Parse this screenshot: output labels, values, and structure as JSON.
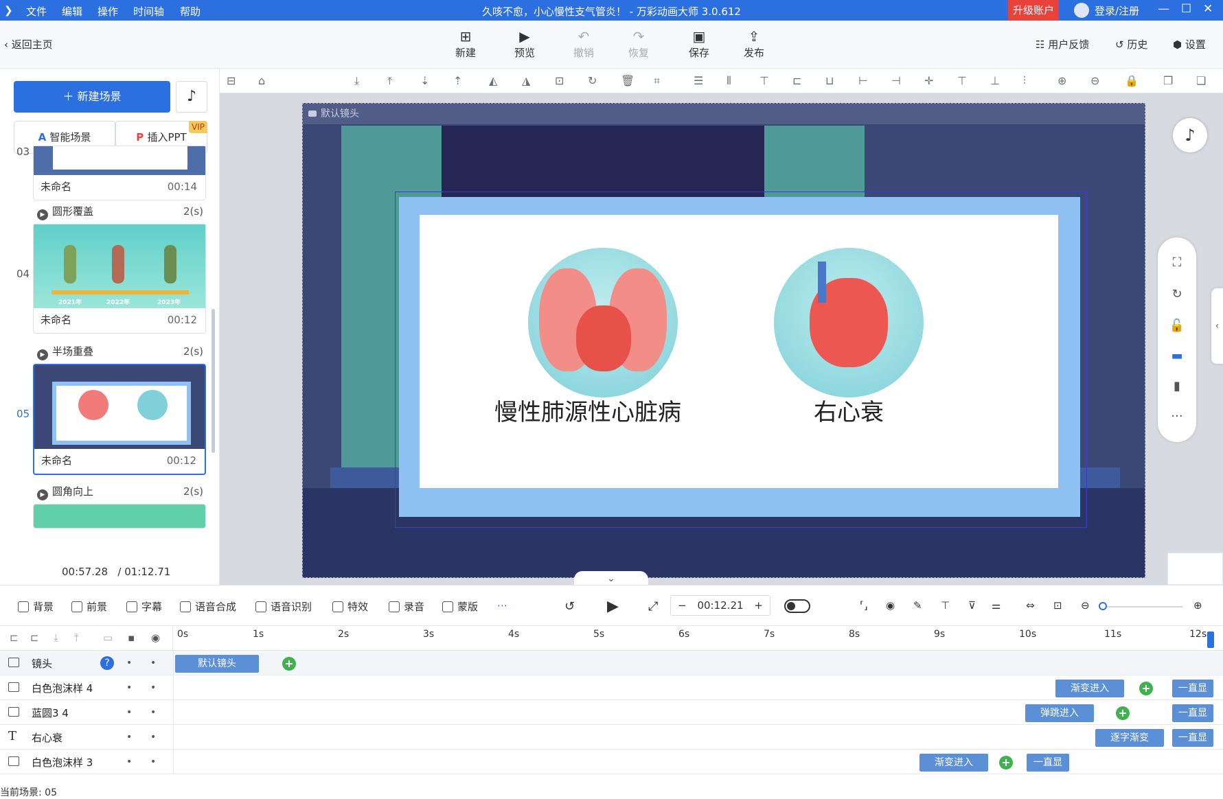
{
  "titlebar": {
    "menus": [
      "文件",
      "编辑",
      "操作",
      "时间轴",
      "帮助"
    ],
    "title": "久咳不愈，小心慢性支气管炎！ - 万彩动画大师 3.0.612",
    "upgrade": "升级账户",
    "login": "登录/注册",
    "accent": "#2c6fe0"
  },
  "toolbar": {
    "back": "返回主页",
    "buttons": [
      {
        "label": "新建",
        "icon": "new-icon"
      },
      {
        "label": "预览",
        "icon": "play-icon"
      },
      {
        "label": "撤销",
        "icon": "undo-icon"
      },
      {
        "label": "恢复",
        "icon": "redo-icon"
      },
      {
        "label": "保存",
        "icon": "save-icon"
      },
      {
        "label": "发布",
        "icon": "publish-icon"
      }
    ],
    "right": [
      "用户反馈",
      "历史",
      "设置"
    ]
  },
  "left": {
    "new_scene": "新建场景",
    "smart_scene": "智能场景",
    "insert_ppt": "插入PPT",
    "vip": "VIP",
    "scenes": [
      {
        "num": "03",
        "name": "未命名",
        "time": "00:14"
      },
      {
        "num": "04",
        "name": "未命名",
        "time": "00:12",
        "labels": [
          "2021年",
          "2022年",
          "2023年"
        ]
      },
      {
        "num": "05",
        "name": "未命名",
        "time": "00:12"
      }
    ],
    "transitions": [
      {
        "name": "圆形覆盖",
        "dur": "2(s)"
      },
      {
        "name": "半场重叠",
        "dur": "2(s)"
      },
      {
        "name": "圆角向上",
        "dur": "2(s)"
      }
    ],
    "time_current": "00:57.28",
    "time_total": "/ 01:12.71"
  },
  "canvas": {
    "lens_label": "默认镜头",
    "left_caption": "慢性肺源性心脏病",
    "right_caption": "右心衰"
  },
  "bottom": {
    "tools": [
      "背景",
      "前景",
      "字幕",
      "语音合成",
      "语音识别",
      "特效",
      "录音",
      "蒙版"
    ],
    "time": "00:12.21",
    "minus": "−",
    "plus": "+"
  },
  "timeline": {
    "ticks": [
      "0s",
      "1s",
      "2s",
      "3s",
      "4s",
      "5s",
      "6s",
      "7s",
      "8s",
      "9s",
      "10s",
      "11s",
      "12s"
    ],
    "tracks": [
      {
        "name": "镜头"
      },
      {
        "name": "白色泡沫样 4"
      },
      {
        "name": "蓝圆3 4"
      },
      {
        "name": "右心衰"
      },
      {
        "name": "白色泡沫样 3"
      }
    ],
    "blocks": {
      "default_lens": "默认镜头",
      "fade_in": "渐变进入",
      "always": "一直显",
      "bounce_in": "弹跳进入",
      "char_fade": "逐字渐变"
    },
    "current_scene": "当前场景: 05"
  }
}
